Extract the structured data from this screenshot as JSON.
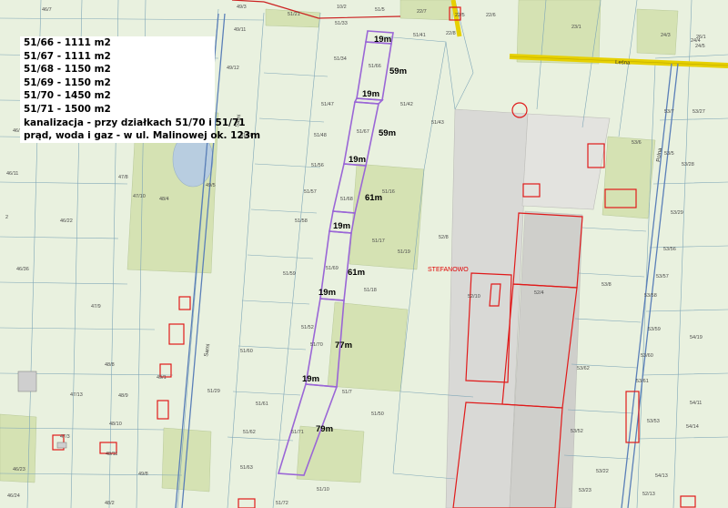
{
  "legend": {
    "lines": [
      "51/66 - 1111 m2",
      "51/67 - 1111 m2",
      "51/68 - 1150 m2",
      "51/69 - 1150 m2",
      "51/70 - 1450 m2",
      "51/71 - 1500 m2",
      "kanalizacja - przy działkach 51/70 i 51/71",
      "prąd, woda i gaz - w ul. Malinowej ok. 123m"
    ]
  },
  "place_name": "STEFANOWO",
  "street_labels": [
    "Sarni",
    "Sarni",
    "Leśna",
    "Polna"
  ],
  "dimensions": [
    "19m",
    "59m",
    "19m",
    "59m",
    "19m",
    "61m",
    "19m",
    "61m",
    "19m",
    "77m",
    "19m",
    "79m"
  ],
  "parcels": [
    "46/7",
    "49/3",
    "51/21",
    "10/2",
    "51/5",
    "22/7",
    "22/5",
    "22/6",
    "23/1",
    "24/3",
    "26/1",
    "51/33",
    "51/41",
    "22/8",
    "24/4",
    "24/5",
    "49/11",
    "51/34",
    "51/66",
    "51/42",
    "49/12",
    "51/47",
    "51/67",
    "51/43",
    "46/1",
    "51/28",
    "51/48",
    "53/7",
    "53/6",
    "53/5",
    "53/27",
    "53/28",
    "51/56",
    "51/16",
    "46/11",
    "51/57",
    "51/68",
    "47/8",
    "47/10",
    "48/4",
    "49/5",
    "52/8",
    "53/29",
    "2",
    "46/22",
    "51/58",
    "51/17",
    "51/19",
    "53/56",
    "46/36",
    "51/69",
    "51/59",
    "53/57",
    "52/4",
    "52/10",
    "53/8",
    "51/18",
    "53/58",
    "47/9",
    "53/59",
    "51/52",
    "51/70",
    "51/60",
    "53/60",
    "54/19",
    "48/8",
    "49/1",
    "53/62",
    "47/13",
    "48/9",
    "51/29",
    "51/61",
    "51/7",
    "51/50",
    "53/61",
    "54/11",
    "48/10",
    "51/62",
    "51/71",
    "53/52",
    "53/53",
    "54/14",
    "47/3",
    "48/11",
    "49/8",
    "51/63",
    "51/10",
    "53/22",
    "54/13",
    "46/23",
    "46/24",
    "48/2",
    "51/72",
    "53/23",
    "52/13"
  ]
}
